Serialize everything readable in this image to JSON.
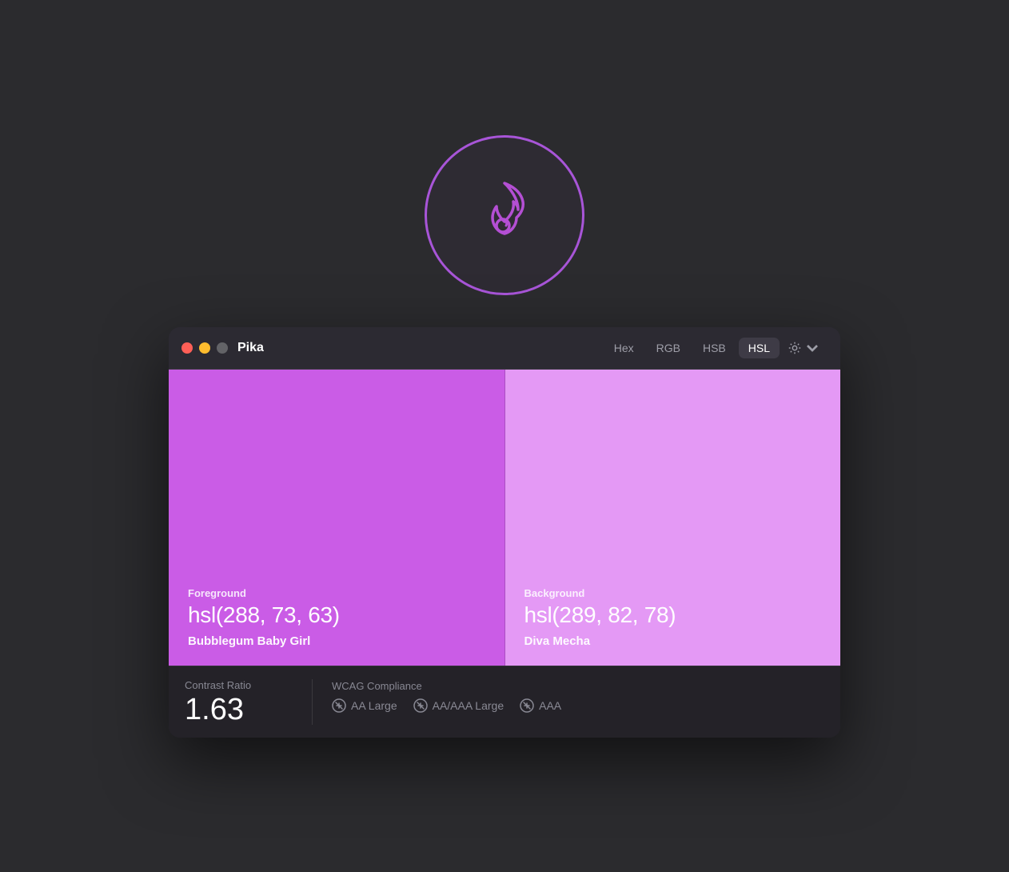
{
  "app": {
    "icon_label": "Pika app icon"
  },
  "window": {
    "title": "Pika",
    "traffic_lights": {
      "close": "close",
      "minimize": "minimize",
      "maximize": "maximize"
    },
    "format_tabs": [
      {
        "label": "Hex",
        "active": false
      },
      {
        "label": "RGB",
        "active": false
      },
      {
        "label": "HSB",
        "active": false
      },
      {
        "label": "HSL",
        "active": true
      }
    ],
    "settings_label": "settings"
  },
  "foreground": {
    "label": "Foreground",
    "value": "hsl(288, 73, 63)",
    "name": "Bubblegum Baby Girl",
    "color": "hsl(288, 73%, 63%)"
  },
  "background": {
    "label": "Background",
    "value": "hsl(289, 82, 78)",
    "name": "Diva Mecha",
    "color": "hsl(289, 82%, 78%)"
  },
  "contrast": {
    "label": "Contrast Ratio",
    "value": "1.63"
  },
  "wcag": {
    "label": "WCAG Compliance",
    "items": [
      {
        "label": "AA Large",
        "pass": false
      },
      {
        "label": "AA/AAA Large",
        "pass": false
      },
      {
        "label": "AAA",
        "pass": false
      }
    ]
  }
}
